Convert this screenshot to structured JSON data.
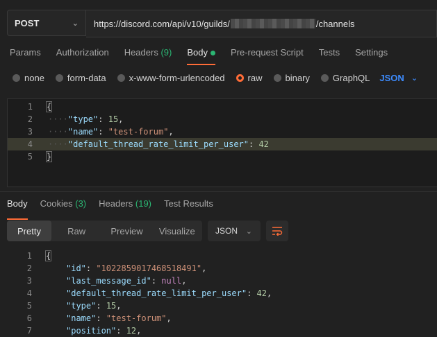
{
  "request": {
    "method": "POST",
    "url_prefix": "https://discord.com/api/v10/guilds/",
    "url_suffix": "/channels"
  },
  "request_tabs": [
    {
      "label": "Params"
    },
    {
      "label": "Authorization"
    },
    {
      "label": "Headers",
      "count": "(9)"
    },
    {
      "label": "Body"
    },
    {
      "label": "Pre-request Script"
    },
    {
      "label": "Tests"
    },
    {
      "label": "Settings"
    }
  ],
  "body_types": [
    "none",
    "form-data",
    "x-www-form-urlencoded",
    "raw",
    "binary",
    "GraphQL"
  ],
  "body_language": "JSON",
  "request_body": {
    "line_numbers": [
      "1",
      "2",
      "3",
      "4",
      "5"
    ],
    "open": "{",
    "close": "}",
    "type_key": "\"type\"",
    "type_val": "15",
    "name_key": "\"name\"",
    "name_val": "\"test-forum\"",
    "rate_key": "\"default_thread_rate_limit_per_user\"",
    "rate_val": "42"
  },
  "response_tabs": [
    {
      "label": "Body"
    },
    {
      "label": "Cookies",
      "count": "(3)"
    },
    {
      "label": "Headers",
      "count": "(19)"
    },
    {
      "label": "Test Results"
    }
  ],
  "view_modes": [
    "Pretty",
    "Raw",
    "Preview",
    "Visualize"
  ],
  "response_format": "JSON",
  "response_body": {
    "line_numbers": [
      "1",
      "2",
      "3",
      "4",
      "5",
      "6",
      "7"
    ],
    "open": "{",
    "id_key": "\"id\"",
    "id_val": "\"1022859017468518491\"",
    "lmid_key": "\"last_message_id\"",
    "lmid_val": "null",
    "rate_key": "\"default_thread_rate_limit_per_user\"",
    "rate_val": "42",
    "type_key": "\"type\"",
    "type_val": "15",
    "name_key": "\"name\"",
    "name_val": "\"test-forum\"",
    "pos_key": "\"position\"",
    "pos_val": "12"
  }
}
